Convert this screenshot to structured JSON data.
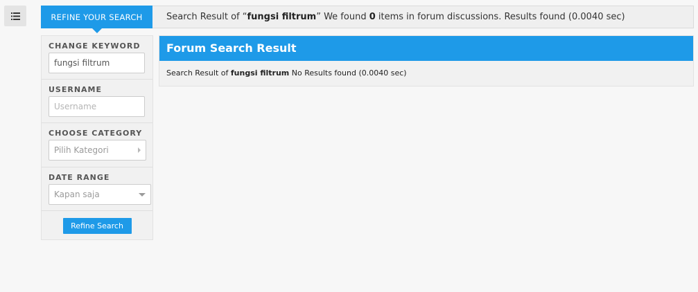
{
  "icons": {
    "menu": "list-icon"
  },
  "topbar": {
    "refine_tab_label": "REFINE YOUR SEARCH",
    "summary_prefix": "Search Result of “",
    "keyword": "fungsi filtrum",
    "summary_middle": "” We found ",
    "count": "0",
    "summary_suffix": " items in forum discussions. Results found (0.0040 sec)"
  },
  "sidebar": {
    "keyword_label": "CHANGE KEYWORD",
    "keyword_value": "fungsi filtrum",
    "username_label": "USERNAME",
    "username_placeholder": "Username",
    "category_label": "CHOOSE CATEGORY",
    "category_value": "Pilih Kategori",
    "date_label": "DATE RANGE",
    "date_value": "Kapan saja",
    "button_label": "Refine Search"
  },
  "results": {
    "title": "Forum Search Result",
    "prefix": "Search Result of ",
    "keyword": "fungsi filtrum",
    "suffix": " No Results found (0.0040 sec)"
  },
  "colors": {
    "accent": "#1e9ae8",
    "background": "#f7f7f7"
  }
}
